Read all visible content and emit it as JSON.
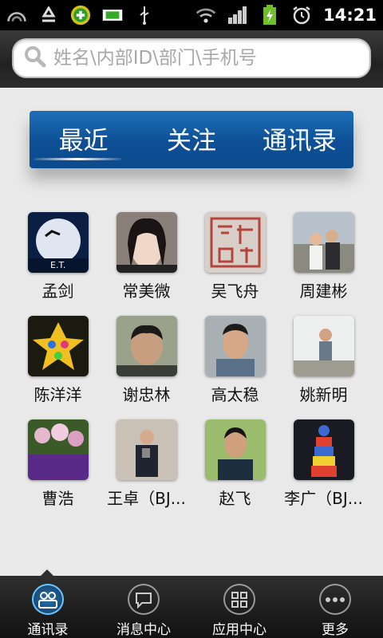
{
  "status_bar": {
    "time": "14:21",
    "icons": [
      "signal-arc-icon",
      "recycle-icon",
      "add-badge-icon",
      "sim-icon",
      "usb-icon",
      "wifi-icon",
      "cell-signal-icon",
      "battery-charging-icon",
      "alarm-icon"
    ]
  },
  "search": {
    "placeholder": "姓名\\内部ID\\部门\\手机号"
  },
  "tabs": [
    {
      "label": "最近",
      "active": true
    },
    {
      "label": "关注",
      "active": false
    },
    {
      "label": "通讯录",
      "active": false
    }
  ],
  "contacts": [
    {
      "name": "孟剑"
    },
    {
      "name": "常美微"
    },
    {
      "name": "吴飞舟"
    },
    {
      "name": "周建彬"
    },
    {
      "name": "陈洋洋"
    },
    {
      "name": "谢忠林"
    },
    {
      "name": "高太稳"
    },
    {
      "name": "姚新明"
    },
    {
      "name": "曹浩"
    },
    {
      "name": "王卓（BJ..."
    },
    {
      "name": "赵飞"
    },
    {
      "name": "李广（BJ..."
    }
  ],
  "bottom_nav": [
    {
      "label": "通讯录",
      "icon": "contacts-icon",
      "active": true
    },
    {
      "label": "消息中心",
      "icon": "message-bubble-icon",
      "active": false
    },
    {
      "label": "应用中心",
      "icon": "apps-grid-icon",
      "active": false
    },
    {
      "label": "更多",
      "icon": "more-dots-icon",
      "active": false
    }
  ],
  "colors": {
    "tab_bar": "#0e4f95",
    "nav_active": "#6cc4ff",
    "background": "#e9e9e9"
  }
}
